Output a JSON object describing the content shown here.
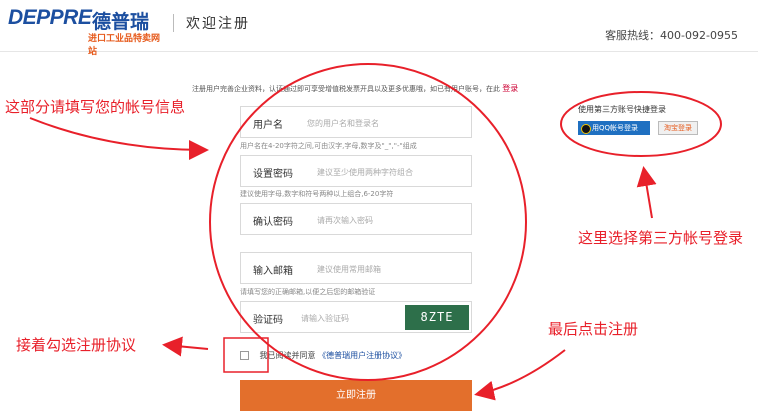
{
  "header": {
    "logo_en": "DEPPRE",
    "logo_cn": "德普瑞",
    "logo_tagline": "进口工业品特卖网站",
    "title": "欢迎注册",
    "hotline": "客服热线：400-092-0955"
  },
  "intro": {
    "text": "注册用户完善企业资料，认证通过即可享受增值税发票开具以及更多优惠哦，如已有用户账号，在此",
    "login_link": "登录"
  },
  "form": {
    "username": {
      "label": "用户名",
      "placeholder": "您的用户名和登录名",
      "hint": "用户名在4-20字符之间,可由汉字,字母,数字及\"_\",\"-\"组成"
    },
    "password": {
      "label": "设置密码",
      "placeholder": "建议至少使用两种字符组合",
      "hint": "建议使用字母,数字和符号两种以上组合,6-20字符"
    },
    "confirm": {
      "label": "确认密码",
      "placeholder": "请再次输入密码"
    },
    "email": {
      "label": "输入邮箱",
      "placeholder": "建议使用常用邮箱",
      "hint": "请填写您的正确邮箱,以便之后您的邮箱验证"
    },
    "captcha": {
      "label": "验证码",
      "placeholder": "请输入验证码",
      "image_text": "8ZTE"
    },
    "agree": {
      "text": "我已阅读并同意",
      "link": "《德普瑞用户注册协议》"
    },
    "submit_label": "立即注册"
  },
  "third_party": {
    "title": "使用第三方账号快捷登录",
    "qq_label": "用QQ帐号登录",
    "taobao_label": "淘宝登录"
  },
  "annotations": {
    "fill_account": "这部分请填写您的帐号信息",
    "choose_third": "这里选择第三方帐号登录",
    "check_agree": "接着勾选注册协议",
    "click_register": "最后点击注册"
  },
  "colors": {
    "brand_blue": "#1c4fa0",
    "submit_orange": "#e36f2c",
    "annotation_red": "#e8202a"
  }
}
